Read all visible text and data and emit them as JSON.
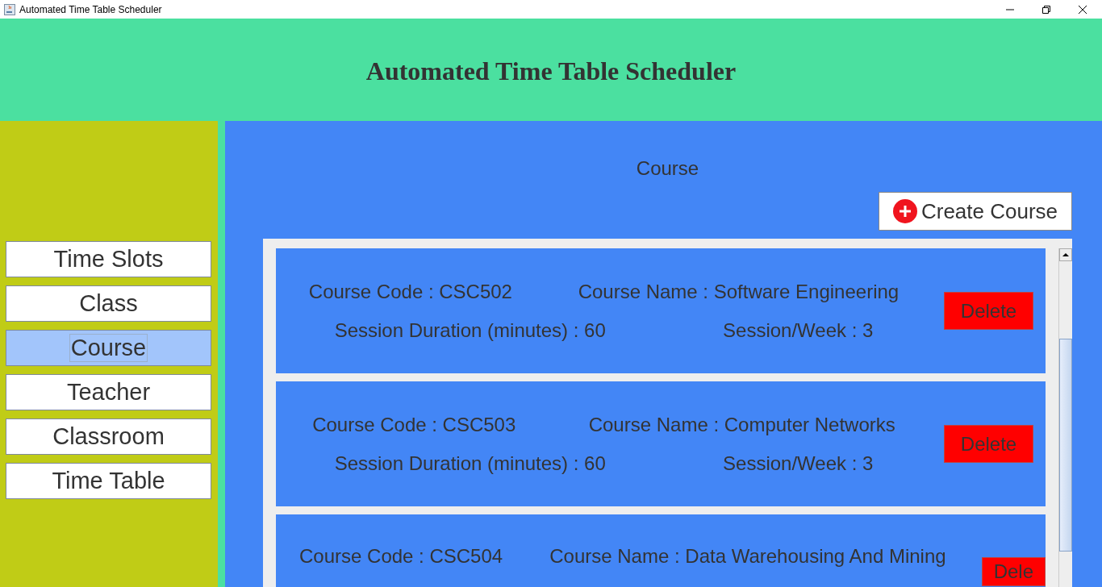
{
  "window": {
    "title": "Automated Time Table Scheduler"
  },
  "header": {
    "title": "Automated Time Table Scheduler"
  },
  "sidebar": {
    "items": [
      {
        "label": "Time Slots",
        "selected": false
      },
      {
        "label": "Class",
        "selected": false
      },
      {
        "label": "Course",
        "selected": true
      },
      {
        "label": "Teacher",
        "selected": false
      },
      {
        "label": "Classroom",
        "selected": false
      },
      {
        "label": "Time Table",
        "selected": false
      }
    ]
  },
  "main": {
    "title": "Course",
    "create_button": "Create Course",
    "courses": [
      {
        "code": "Course Code : CSC502",
        "name": "Course Name : Software Engineering",
        "duration": "Session Duration (minutes) : 60",
        "per_week": "Session/Week : 3",
        "delete": "Delete"
      },
      {
        "code": "Course Code : CSC503",
        "name": "Course Name : Computer Networks",
        "duration": "Session Duration (minutes) : 60",
        "per_week": "Session/Week : 3",
        "delete": "Delete"
      },
      {
        "code": "Course Code : CSC504",
        "name": "Course Name : Data Warehousing And Mining",
        "delete": "Dele"
      }
    ]
  }
}
